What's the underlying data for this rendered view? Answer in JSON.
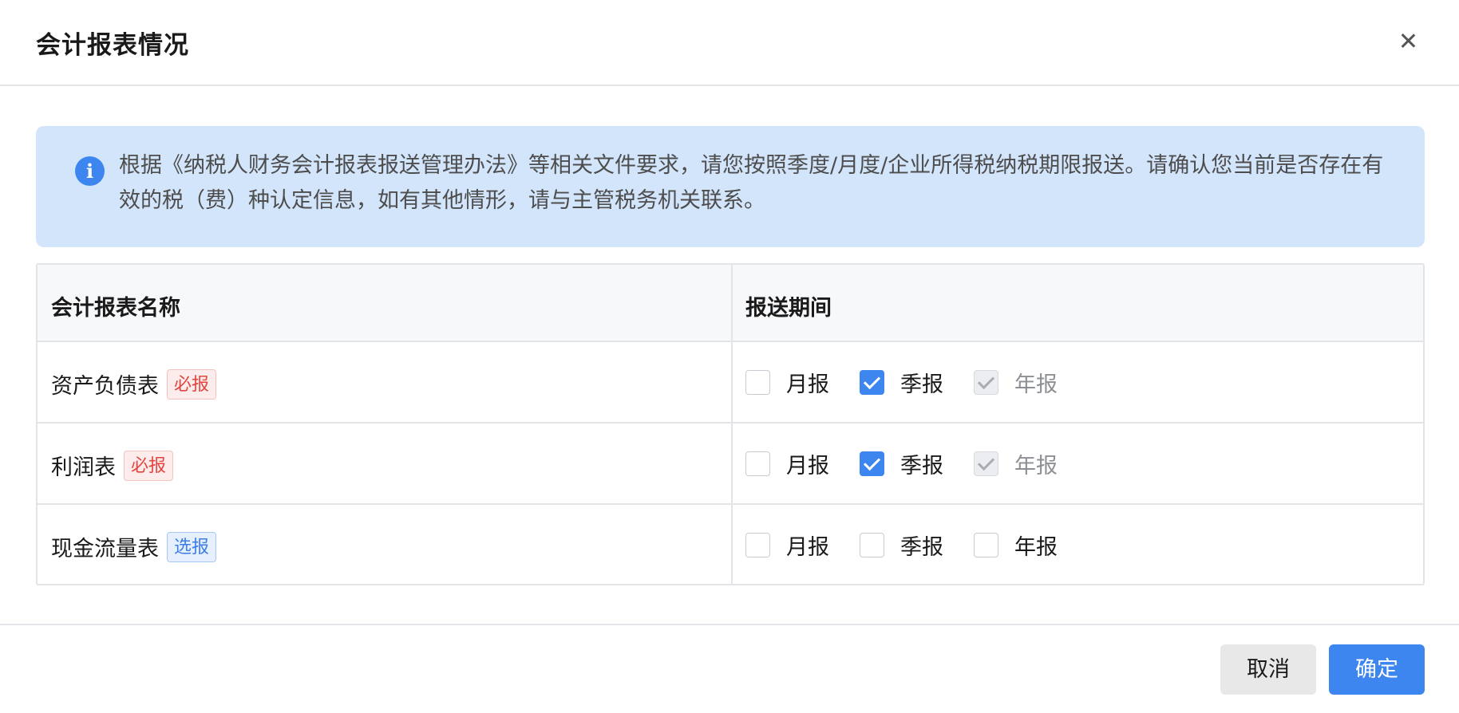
{
  "dialog": {
    "title": "会计报表情况",
    "close_icon": "close-icon"
  },
  "notice": {
    "icon": "info-icon",
    "icon_glyph": "i",
    "text": "根据《纳税人财务会计报表报送管理办法》等相关文件要求，请您按照季度/月度/企业所得税纳税期限报送。请确认您当前是否存在有效的税（费）种认定信息，如有其他情形，请与主管税务机关联系。"
  },
  "table": {
    "headers": [
      "会计报表名称",
      "报送期间"
    ],
    "rows": [
      {
        "name": "资产负债表",
        "tag": "必报",
        "tag_type": "required",
        "options": [
          {
            "label": "月报",
            "state": "unchecked"
          },
          {
            "label": "季报",
            "state": "checked"
          },
          {
            "label": "年报",
            "state": "checked-disabled"
          }
        ]
      },
      {
        "name": "利润表",
        "tag": "必报",
        "tag_type": "required",
        "options": [
          {
            "label": "月报",
            "state": "unchecked"
          },
          {
            "label": "季报",
            "state": "checked"
          },
          {
            "label": "年报",
            "state": "checked-disabled"
          }
        ]
      },
      {
        "name": "现金流量表",
        "tag": "选报",
        "tag_type": "optional",
        "options": [
          {
            "label": "月报",
            "state": "unchecked"
          },
          {
            "label": "季报",
            "state": "unchecked"
          },
          {
            "label": "年报",
            "state": "unchecked"
          }
        ]
      }
    ]
  },
  "footer": {
    "cancel_label": "取消",
    "confirm_label": "确定"
  },
  "colors": {
    "primary": "#3d86f0",
    "notice_bg": "#d3e5fb",
    "required_tag": "#e3453f",
    "optional_tag": "#3d7ee8"
  }
}
